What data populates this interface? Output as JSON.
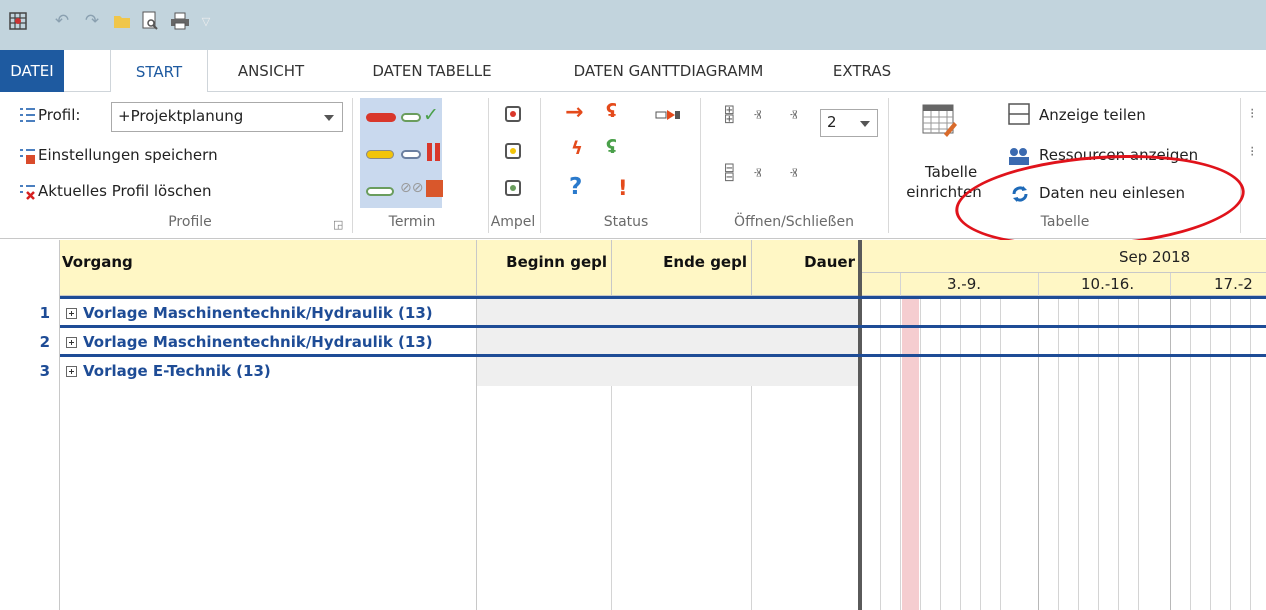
{
  "tabs": {
    "file": "DATEI",
    "start": "START",
    "ansicht": "ANSICHT",
    "daten_tabelle": "DATEN TABELLE",
    "daten_gantt": "DATEN GANTTDIAGRAMM",
    "extras": "EXTRAS"
  },
  "ribbon": {
    "profile": {
      "label": "Profil:",
      "value": "+Projektplanung",
      "save": "Einstellungen speichern",
      "delete": "Aktuelles Profil löschen",
      "group": "Profile"
    },
    "termin": {
      "group": "Termin"
    },
    "ampel": {
      "group": "Ampel"
    },
    "status": {
      "group": "Status"
    },
    "oeffnen": {
      "group": "Öffnen/Schließen",
      "level": "2"
    },
    "tabelle": {
      "einrichten_line1": "Tabelle",
      "einrichten_line2": "einrichten",
      "anzeige_teilen": "Anzeige teilen",
      "ressourcen": "Ressourcen anzeigen",
      "neu_einlesen": "Daten neu einlesen",
      "group": "Tabelle"
    }
  },
  "grid": {
    "columns": {
      "vorgang": "Vorgang",
      "beginn": "Beginn gepl",
      "ende": "Ende gepl",
      "dauer": "Dauer"
    },
    "timeline": {
      "month": "Sep 2018",
      "weeks": [
        "3.-9.",
        "10.-16.",
        "17.-2"
      ]
    },
    "rows": [
      {
        "num": "1",
        "name": "Vorlage Maschinentechnik/Hydraulik (13)"
      },
      {
        "num": "2",
        "name": "Vorlage Maschinentechnik/Hydraulik (13)"
      },
      {
        "num": "3",
        "name": "Vorlage E-Technik (13)"
      }
    ]
  },
  "colors": {
    "accent": "#1e5aa0",
    "header_bg": "#fff7c5",
    "annotation": "#e0131b"
  }
}
